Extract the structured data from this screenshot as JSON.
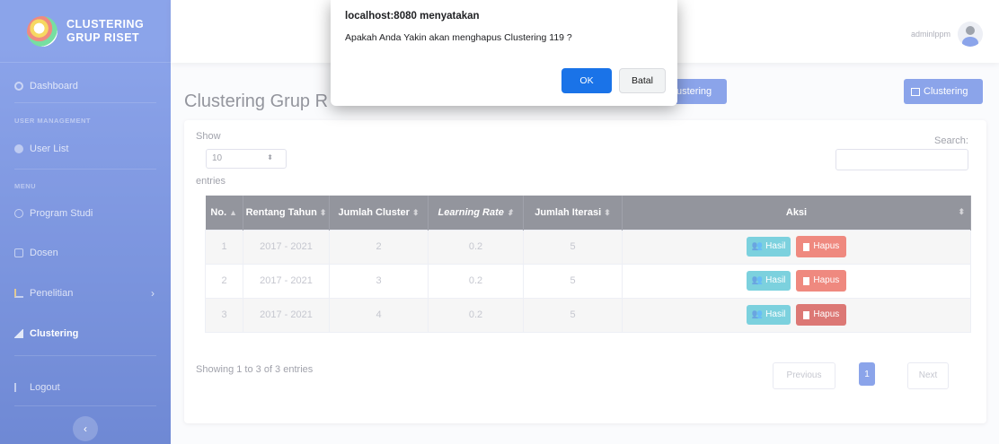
{
  "sidebar": {
    "brand_line1": "CLUSTERING",
    "brand_line2": "GRUP RISET",
    "dashboard": "Dashboard",
    "heading_user": "USER MANAGEMENT",
    "user_list": "User List",
    "heading_menu": "MENU",
    "program_studi": "Program Studi",
    "dosen": "Dosen",
    "penelitian": "Penelitian",
    "clustering": "Clustering",
    "logout": "Logout",
    "toggle_icon": "‹"
  },
  "topbar": {
    "user_name": "adminlppm"
  },
  "page": {
    "title": "Clustering Grup R",
    "btn_partial_label": "ustering",
    "btn_cluster_label": "Clustering"
  },
  "table_controls": {
    "show": "Show",
    "length_value": "10",
    "entries": "entries",
    "search": "Search:"
  },
  "table": {
    "headers": [
      "No.",
      "Rentang Tahun",
      "Jumlah Cluster",
      "Learning Rate",
      "Jumlah Iterasi",
      "Aksi"
    ],
    "rows": [
      {
        "no": "1",
        "tahun": "2017 - 2021",
        "cluster": "2",
        "lr": "0.2",
        "iterasi": "5"
      },
      {
        "no": "2",
        "tahun": "2017 - 2021",
        "cluster": "3",
        "lr": "0.2",
        "iterasi": "5"
      },
      {
        "no": "3",
        "tahun": "2017 - 2021",
        "cluster": "4",
        "lr": "0.2",
        "iterasi": "5"
      }
    ],
    "btn_hasil": "Hasil",
    "btn_hapus": "Hapus"
  },
  "footer": {
    "info": "Showing 1 to 3 of 3 entries",
    "previous": "Previous",
    "page": "1",
    "next": "Next"
  },
  "dialog": {
    "title": "localhost:8080 menyatakan",
    "message": "Apakah Anda Yakin akan menghapus Clustering 119 ?",
    "ok": "OK",
    "cancel": "Batal"
  },
  "colors": {
    "primary": "#4e73df",
    "info": "#36b9cc",
    "danger": "#e74a3b",
    "dialog_ok": "#1a73e8"
  }
}
